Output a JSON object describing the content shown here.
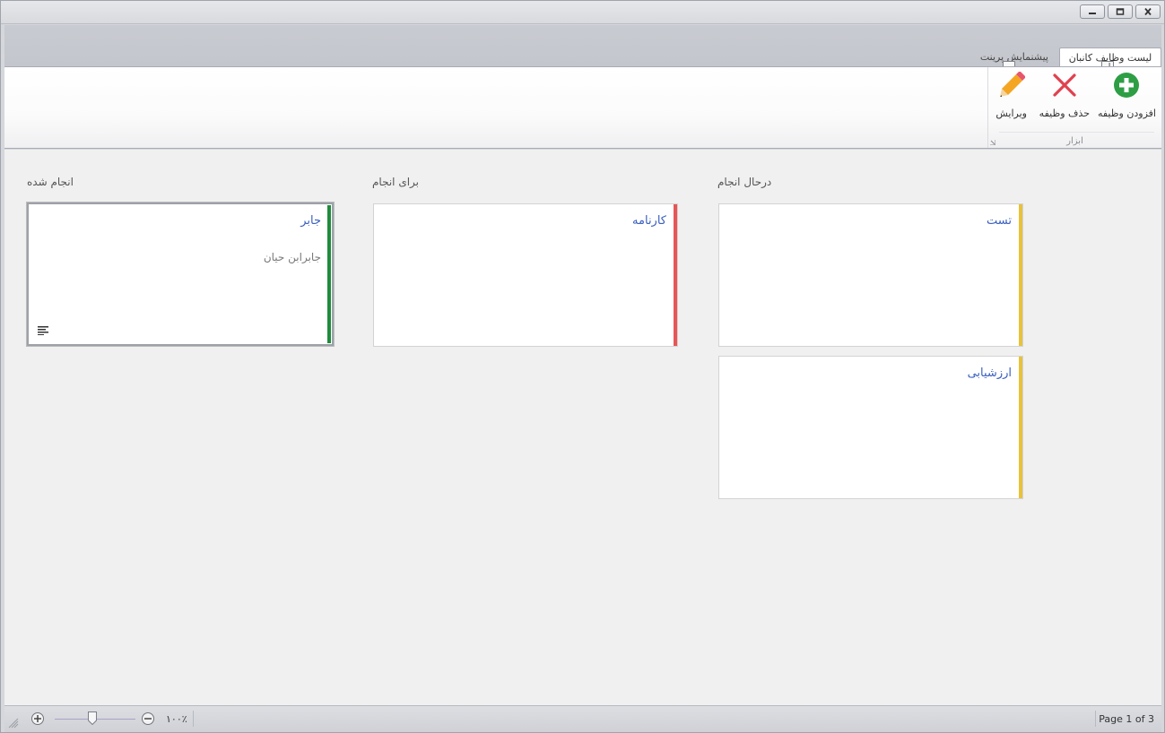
{
  "window": {
    "buttons": [
      "minimize",
      "maximize",
      "close"
    ]
  },
  "ribbon": {
    "tabs": [
      {
        "label": "لیست وظایف کانبان",
        "keytip": "ل",
        "active": true
      },
      {
        "label": "پیشنمایش پرینت",
        "keytip": "پ",
        "active": false
      }
    ],
    "group": {
      "label": "ابزار",
      "buttons": [
        {
          "label": "افزودن وظیفه",
          "icon": "add-circle-icon",
          "color": "#2e9e45"
        },
        {
          "label": "حذف وظیفه",
          "icon": "delete-x-icon",
          "color": "#e0414f"
        },
        {
          "label": "ویرایش",
          "icon": "pencil-icon",
          "color": "#f0a020"
        }
      ]
    }
  },
  "board": {
    "columns": [
      {
        "title": "درحال انجام",
        "cards": [
          {
            "title": "تست",
            "description": "",
            "accent": "#e8c23a"
          },
          {
            "title": "ارزشیابی",
            "description": "",
            "accent": "#e8c23a"
          }
        ]
      },
      {
        "title": "برای انجام",
        "cards": [
          {
            "title": "کارنامه",
            "description": "",
            "accent": "#e85555"
          }
        ]
      },
      {
        "title": "انجام شده",
        "cards": [
          {
            "title": "جابر",
            "description": "جابرابن حیان",
            "accent": "#1e8c3c",
            "has_note_icon": true,
            "selected": true
          }
        ]
      }
    ]
  },
  "statusbar": {
    "zoom_value": "۱۰۰٪",
    "zoom_percent": 100,
    "page_info": "Page 1 of 3"
  }
}
